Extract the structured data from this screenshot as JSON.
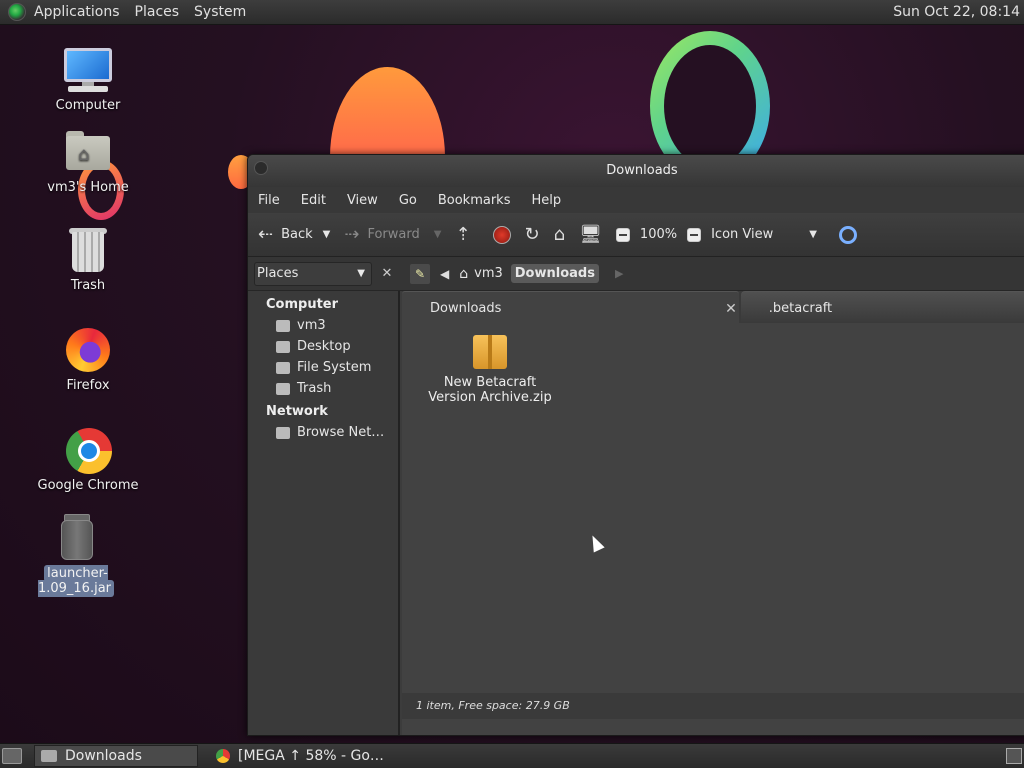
{
  "top_panel": {
    "menus": [
      "Applications",
      "Places",
      "System"
    ],
    "clock": "Sun Oct 22, 08:14"
  },
  "desktop_icons": [
    {
      "label": "Computer",
      "icon": "computer-icon"
    },
    {
      "label": "vm3's Home",
      "icon": "home-folder-icon"
    },
    {
      "label": "Trash",
      "icon": "trash-icon"
    },
    {
      "label": "Firefox",
      "icon": "firefox-icon"
    },
    {
      "label": "Google Chrome",
      "icon": "chrome-icon"
    },
    {
      "label": "launcher-1.09_16.jar",
      "icon": "jar-file-icon",
      "selected": true
    }
  ],
  "window": {
    "title": "Downloads",
    "menus": [
      "File",
      "Edit",
      "View",
      "Go",
      "Bookmarks",
      "Help"
    ],
    "toolbar": {
      "back": "Back",
      "forward": "Forward",
      "zoom": "100%",
      "view_mode": "Icon View"
    },
    "location": {
      "places_label": "Places",
      "breadcrumbs": [
        "vm3",
        "Downloads"
      ]
    },
    "sidebar": {
      "sections": [
        {
          "title": "Computer",
          "items": [
            "vm3",
            "Desktop",
            "File System",
            "Trash"
          ]
        },
        {
          "title": "Network",
          "items": [
            "Browse Net…"
          ]
        }
      ]
    },
    "tabs": [
      "Downloads",
      ".betacraft"
    ],
    "files": [
      {
        "name": "New Betacraft Version Archive.zip",
        "icon": "archive-icon"
      }
    ],
    "status": "1 item, Free space: 27.9 GB"
  },
  "taskbar": {
    "tasks": [
      "Downloads",
      "[MEGA ↑ 58% - Go…"
    ]
  }
}
